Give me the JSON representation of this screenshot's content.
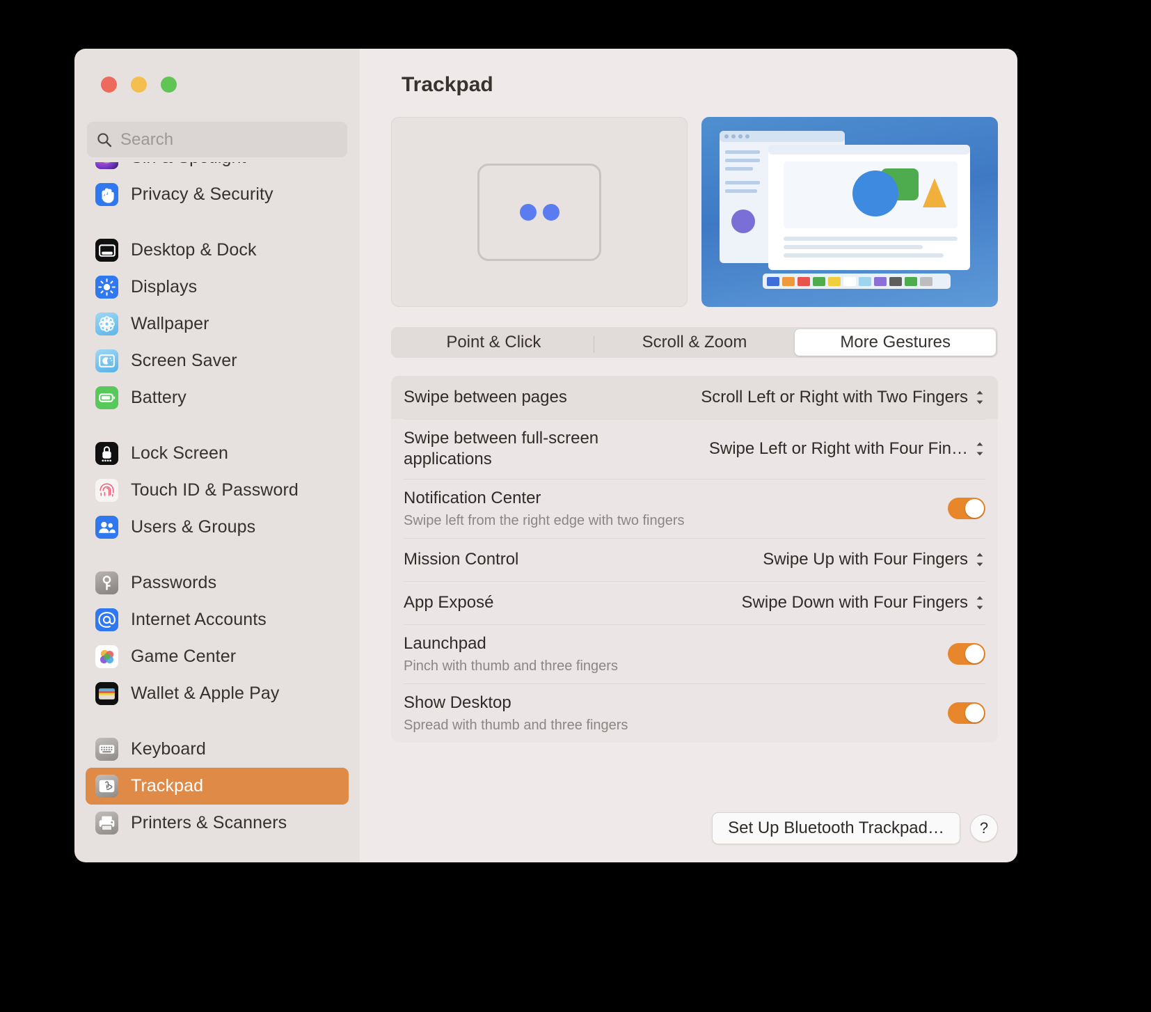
{
  "window": {
    "traffic_lights": [
      "close",
      "minimize",
      "zoom"
    ],
    "accent_color": "#E08A48",
    "toggle_on_color": "#E8862B"
  },
  "search": {
    "placeholder": "Search",
    "value": "",
    "icon": "search-icon"
  },
  "sidebar": {
    "groups": [
      {
        "items": [
          {
            "label": "Siri & Spotlight",
            "icon": "siri-icon",
            "selected": false,
            "clipped": true
          },
          {
            "label": "Privacy & Security",
            "icon": "hand-shield-icon",
            "selected": false
          }
        ]
      },
      {
        "items": [
          {
            "label": "Desktop & Dock",
            "icon": "desktop-dock-icon",
            "selected": false
          },
          {
            "label": "Displays",
            "icon": "display-brightness-icon",
            "selected": false
          },
          {
            "label": "Wallpaper",
            "icon": "wallpaper-flower-icon",
            "selected": false
          },
          {
            "label": "Screen Saver",
            "icon": "screen-saver-moon-icon",
            "selected": false
          },
          {
            "label": "Battery",
            "icon": "battery-icon",
            "selected": false
          }
        ]
      },
      {
        "items": [
          {
            "label": "Lock Screen",
            "icon": "lock-icon",
            "selected": false
          },
          {
            "label": "Touch ID & Password",
            "icon": "fingerprint-icon",
            "selected": false
          },
          {
            "label": "Users & Groups",
            "icon": "users-group-icon",
            "selected": false
          }
        ]
      },
      {
        "items": [
          {
            "label": "Passwords",
            "icon": "key-icon",
            "selected": false
          },
          {
            "label": "Internet Accounts",
            "icon": "at-sign-icon",
            "selected": false
          },
          {
            "label": "Game Center",
            "icon": "game-center-bubbles-icon",
            "selected": false
          },
          {
            "label": "Wallet & Apple Pay",
            "icon": "wallet-icon",
            "selected": false
          }
        ]
      },
      {
        "items": [
          {
            "label": "Keyboard",
            "icon": "keyboard-icon",
            "selected": false
          },
          {
            "label": "Trackpad",
            "icon": "trackpad-icon",
            "selected": true
          },
          {
            "label": "Printers & Scanners",
            "icon": "printer-icon",
            "selected": false
          }
        ]
      }
    ]
  },
  "main": {
    "title": "Trackpad",
    "preview": {
      "trackpad_gesture": "two-finger-dots",
      "illustration": "desktop-spaces-illustration"
    },
    "tabs": [
      {
        "label": "Point & Click",
        "active": false
      },
      {
        "label": "Scroll & Zoom",
        "active": false
      },
      {
        "label": "More Gestures",
        "active": true
      }
    ],
    "settings": [
      {
        "title": "Swipe between pages",
        "subtitle": "",
        "control": "popup",
        "value": "Scroll Left or Right with Two Fingers",
        "highlighted": true
      },
      {
        "title": "Swipe between full-screen applications",
        "subtitle": "",
        "control": "popup",
        "value": "Swipe Left or Right with Four Fin…",
        "highlighted": false
      },
      {
        "title": "Notification Center",
        "subtitle": "Swipe left from the right edge with two fingers",
        "control": "toggle",
        "value": "on",
        "highlighted": false
      },
      {
        "title": "Mission Control",
        "subtitle": "",
        "control": "popup",
        "value": "Swipe Up with Four Fingers",
        "highlighted": false
      },
      {
        "title": "App Exposé",
        "subtitle": "",
        "control": "popup",
        "value": "Swipe Down with Four Fingers",
        "highlighted": false
      },
      {
        "title": "Launchpad",
        "subtitle": "Pinch with thumb and three fingers",
        "control": "toggle",
        "value": "on",
        "highlighted": false
      },
      {
        "title": "Show Desktop",
        "subtitle": "Spread with thumb and three fingers",
        "control": "toggle",
        "value": "on",
        "highlighted": false
      }
    ],
    "footer": {
      "setup_button": "Set Up Bluetooth Trackpad…",
      "help_button": "?"
    }
  }
}
